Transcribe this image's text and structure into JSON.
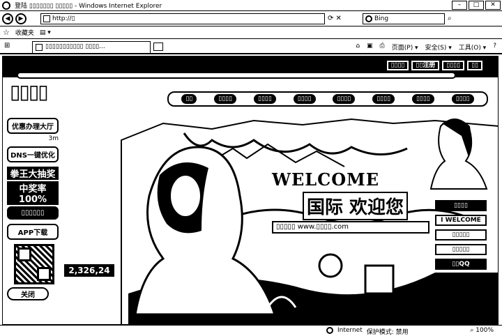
{
  "browser": {
    "window_title": "登陆 ▯▯▯▯▯▯▯ ▯▯▯▯▯ - Windows Internet Explorer",
    "address": "http://▯",
    "search_placeholder": "Bing",
    "favorites_label": "收藏夹",
    "tab_title": "▯▯▯▯▯▯▯▯▯▯▯ ▯▯▯▯...",
    "cmd_items": [
      "页面(P) ▾",
      "安全(S) ▾",
      "工具(O) ▾",
      "?"
    ],
    "status_zone": "Internet",
    "status_mode": "保护模式: 禁用",
    "zoom": "100%"
  },
  "page": {
    "top_links": [
      "▯▯▯▯",
      "▯▯注册",
      "▯▯▯▯",
      "▯▯"
    ],
    "logo_text": "▯▯▯▯",
    "nav_items": [
      "▯▯",
      "▯▯▯▯",
      "▯▯▯▯",
      "▯▯▯▯",
      "▯▯▯▯",
      "▯▯▯▯",
      "▯▯▯▯",
      "▯▯▯▯"
    ],
    "sidebar": {
      "offers_button": "优惠办理大厅",
      "offers_sub": "3m",
      "dns_button": "DNS一键优化",
      "lottery_title": "拳王大抽奖",
      "lottery_sub": "中奖率100%",
      "mid_label": "▯▯▯▯▯▯",
      "app_button": "APP下载",
      "close_button": "关闭"
    },
    "welcome": {
      "title": "WELCOME",
      "subtitle": "国际 欢迎您",
      "url_bar": "▯▯▯▯▯ www.▯▯▯▯.com"
    },
    "counter": "2,326,24",
    "right_tools": [
      "▯▯▯▯",
      "I WELCOME",
      "▯▯▯▯▯",
      "▯▯▯▯▯",
      "▯▯QQ"
    ]
  }
}
